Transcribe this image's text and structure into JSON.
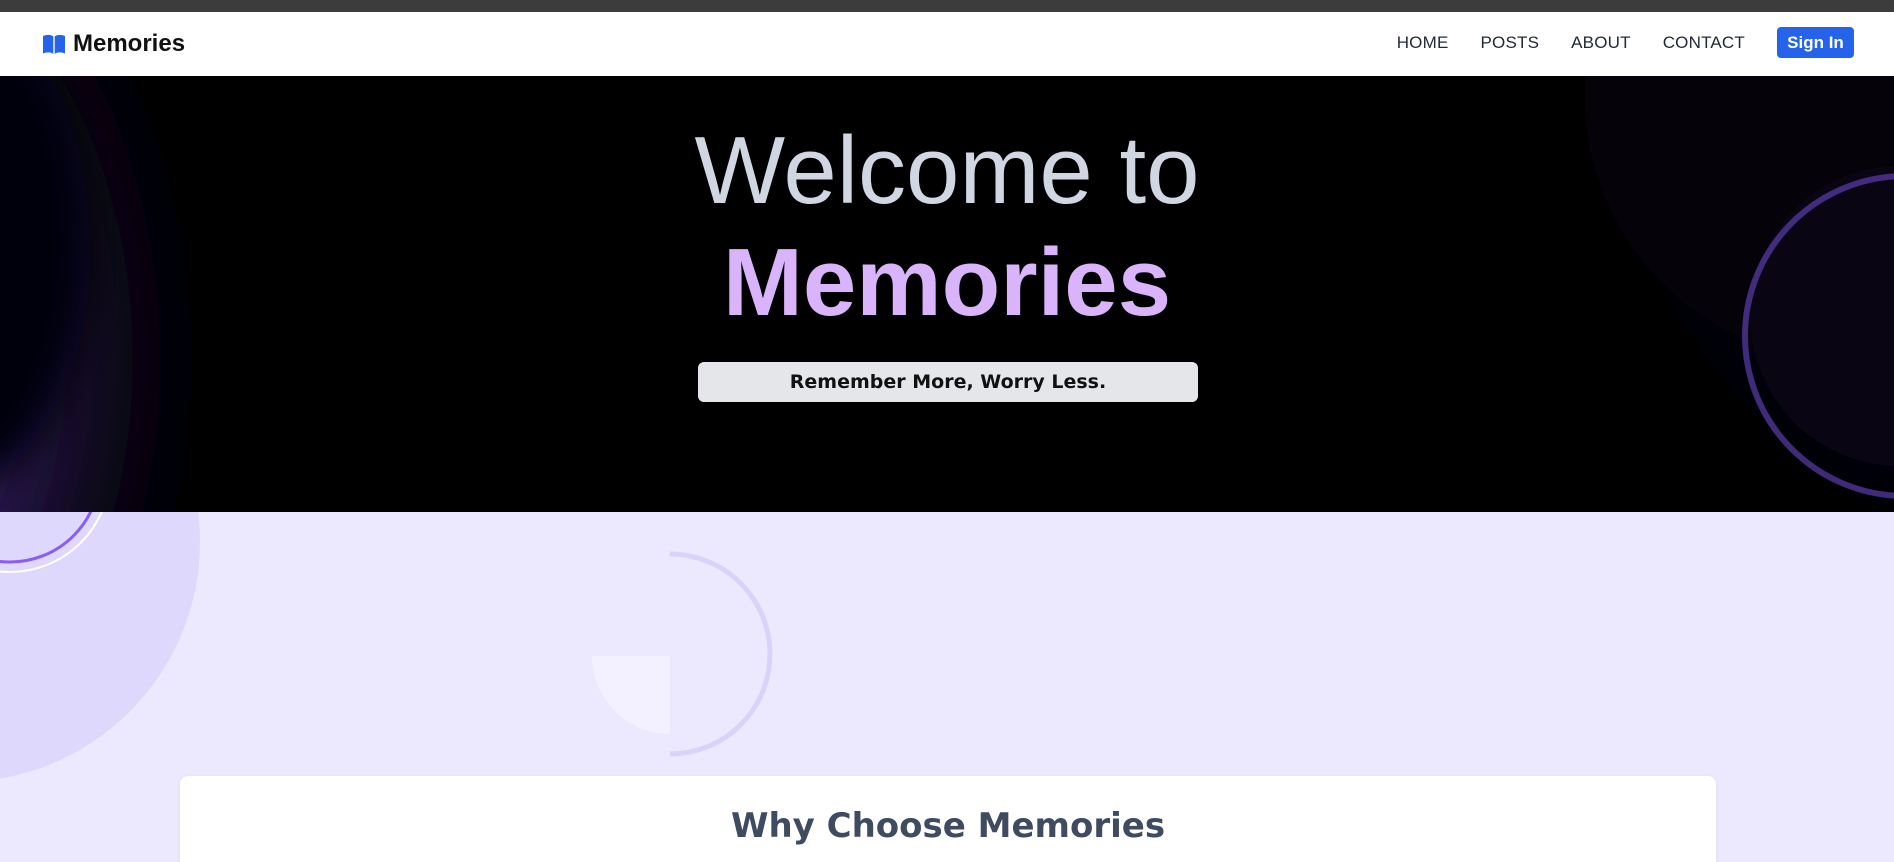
{
  "navbar": {
    "brand": "Memories",
    "brand_icon": "open-book-icon",
    "links": [
      "HOME",
      "POSTS",
      "ABOUT",
      "CONTACT"
    ],
    "signin_label": "Sign In",
    "signin_color": "#2563eb"
  },
  "hero": {
    "title_line1": "Welcome to",
    "title_line2": "Memories",
    "tagline": "Remember More, Worry Less.",
    "accent_color": "#d9b4fb",
    "glow_color": "#5b3bb0"
  },
  "features": {
    "title": "Why Choose Memories"
  }
}
